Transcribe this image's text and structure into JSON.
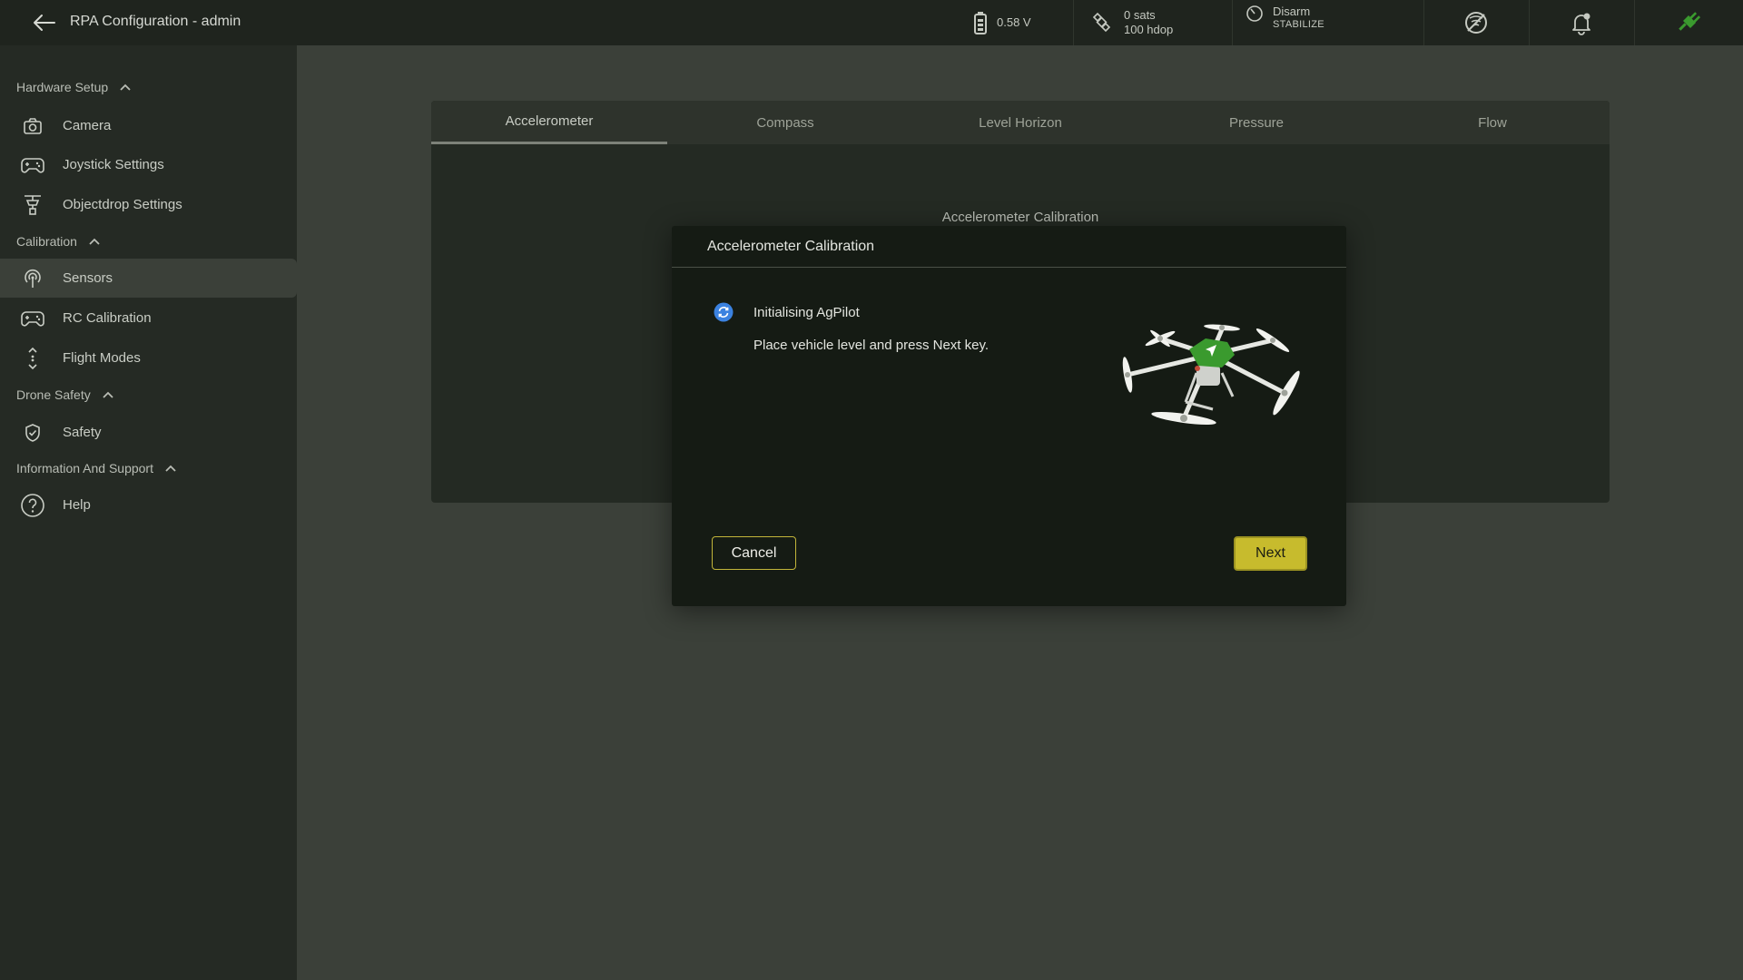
{
  "header": {
    "title": "RPA Configuration - admin",
    "battery": "0.58 V",
    "gps_sats": "0 sats",
    "gps_hdop": "100 hdop",
    "arm_state": "Disarm",
    "flight_mode": "STABILIZE"
  },
  "sidebar": {
    "sections": [
      {
        "label": "Hardware Setup",
        "items": [
          {
            "label": "Camera",
            "icon": "camera-icon"
          },
          {
            "label": "Joystick Settings",
            "icon": "gamepad-icon"
          },
          {
            "label": "Objectdrop Settings",
            "icon": "drop-icon"
          }
        ]
      },
      {
        "label": "Calibration",
        "items": [
          {
            "label": "Sensors",
            "icon": "sensor-icon"
          },
          {
            "label": "RC Calibration",
            "icon": "gamepad-icon"
          },
          {
            "label": "Flight Modes",
            "icon": "flight-modes-icon"
          }
        ]
      },
      {
        "label": "Drone Safety",
        "items": [
          {
            "label": "Safety",
            "icon": "shield-icon"
          }
        ]
      },
      {
        "label": "Information And Support",
        "items": [
          {
            "label": "Help",
            "icon": "help-icon"
          }
        ]
      }
    ],
    "active_item": "Sensors"
  },
  "tabs": [
    {
      "label": "Accelerometer"
    },
    {
      "label": "Compass"
    },
    {
      "label": "Level Horizon"
    },
    {
      "label": "Pressure"
    },
    {
      "label": "Flow"
    }
  ],
  "active_tab": "Accelerometer",
  "panel": {
    "heading": "Accelerometer Calibration"
  },
  "modal": {
    "title": "Accelerometer Calibration",
    "step_label": "Initialising AgPilot",
    "message": "Place vehicle level and press Next key.",
    "cancel_label": "Cancel",
    "next_label": "Next"
  },
  "colors": {
    "accent": "#c7bb2d",
    "drone_body": "#3a9a2e",
    "spinner": "#3b82e0"
  }
}
